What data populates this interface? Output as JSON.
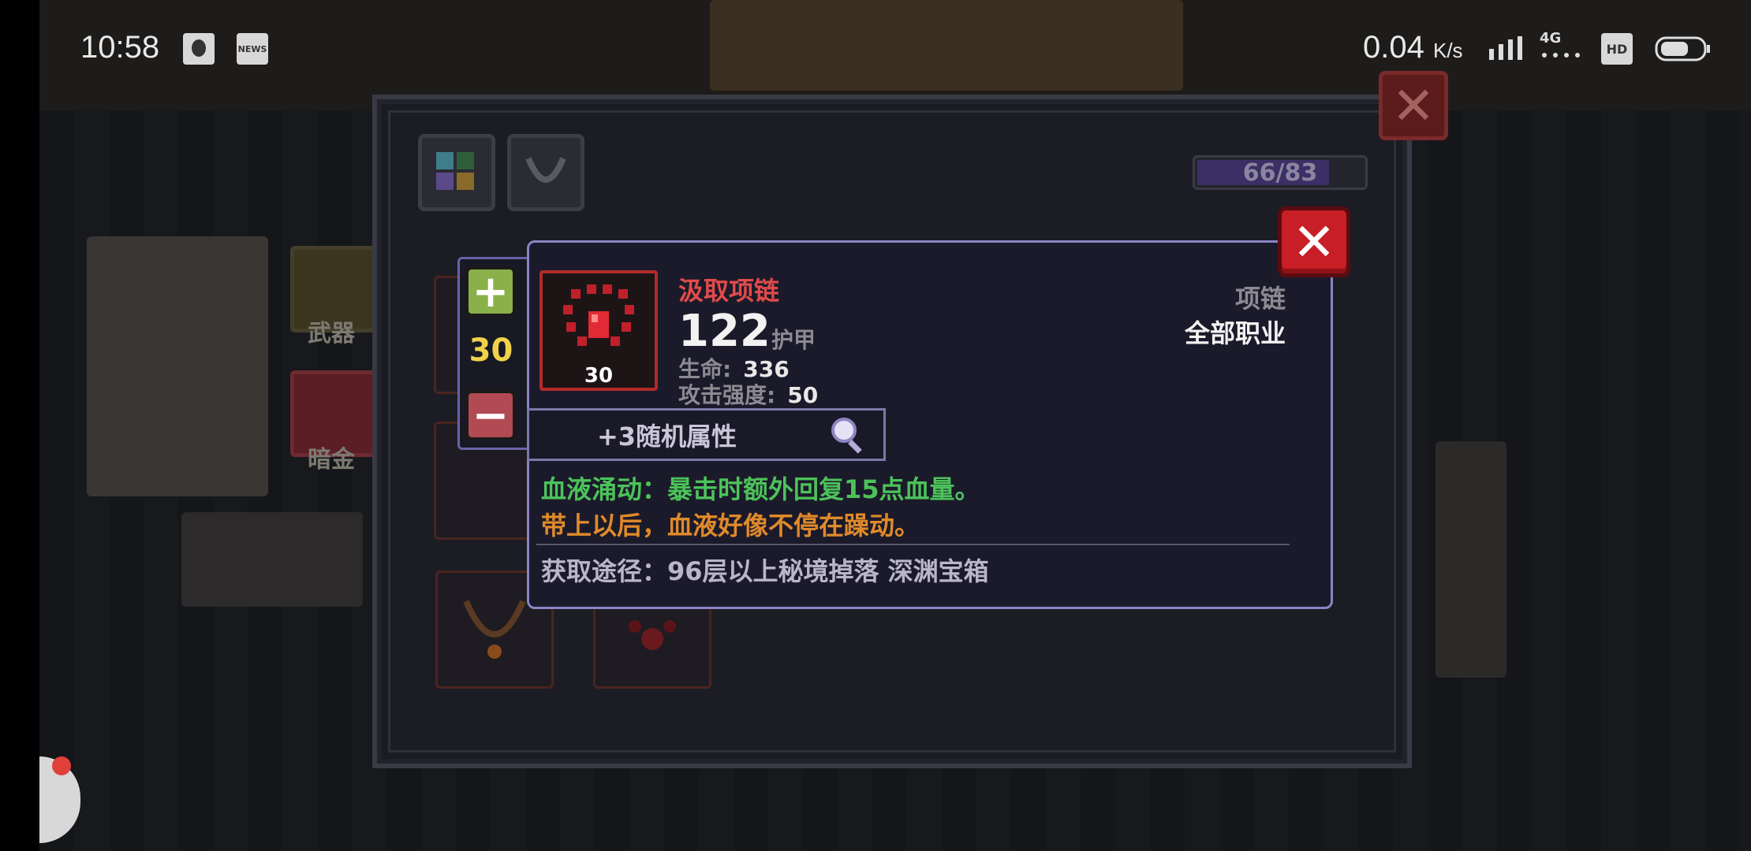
{
  "status_bar": {
    "time": "10:58",
    "network_speed": "0.04",
    "network_unit": "K/s",
    "network_type": "4G",
    "hd_label": "HD",
    "news_label": "NEWS",
    "icons": [
      "qq-icon",
      "news-icon",
      "signal-icon",
      "hd-icon",
      "battery-icon"
    ]
  },
  "background": {
    "sidebar_weapon_label": "武器",
    "sidebar_gold_label": "暗金"
  },
  "inventory": {
    "capacity_text": "66/83",
    "capacity_fraction": 0.797,
    "tabs": [
      "grid-tab-icon",
      "necklace-tab-icon"
    ]
  },
  "stepper": {
    "level": "30",
    "plus_label": "+",
    "minus_label": "−"
  },
  "item": {
    "name": "汲取项链",
    "level_badge": "30",
    "armor_value": "122",
    "armor_label": "护甲",
    "stats": [
      {
        "label": "生命:",
        "value": "336"
      },
      {
        "label": "攻击强度:",
        "value": "50"
      }
    ],
    "type": "项链",
    "class": "全部职业",
    "random_attr": "+3随机属性",
    "effect": "血液涌动：暴击时额外回复15点血量。",
    "flavor": "带上以后，血液好像不停在躁动。",
    "source": "获取途径：96层以上秘境掉落 深渊宝箱",
    "name_color": "#e04b4b",
    "effect_color": "#4cc35a",
    "flavor_color": "#e08a2a"
  },
  "close_label": "✕"
}
